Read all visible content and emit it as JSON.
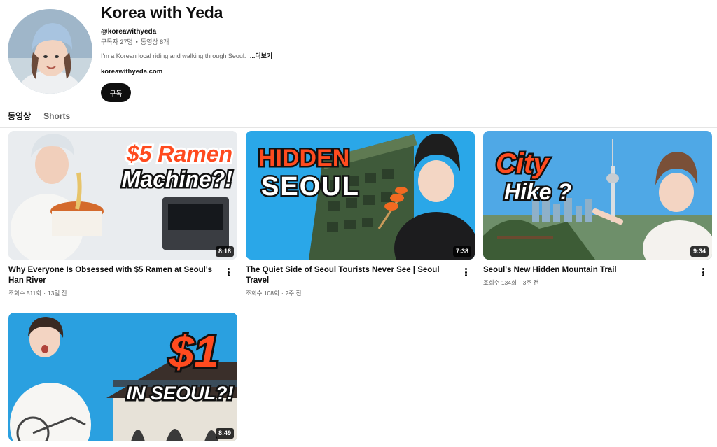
{
  "channel": {
    "title": "Korea with Yeda",
    "handle": "@koreawithyeda",
    "subscribers": "구독자 27명",
    "separator": "•",
    "video_count": "동영상 8개",
    "description": "I'm a Korean local riding and walking through Seoul.",
    "more_label": "...더보기",
    "website": "koreawithyeda.com",
    "subscribe_label": "구독"
  },
  "tabs": [
    {
      "label": "동영상",
      "active": true
    },
    {
      "label": "Shorts",
      "active": false
    }
  ],
  "videos": [
    {
      "title": "Why Everyone Is Obsessed with $5 Ramen at Seoul's Han River",
      "views": "조회수 511회",
      "age": "13일 전",
      "duration": "8:18",
      "thumb_text_1": "$5 Ramen",
      "thumb_text_2": "Machine?!"
    },
    {
      "title": "The Quiet Side of Seoul Tourists Never See | Seoul Travel",
      "views": "조회수 108회",
      "age": "2주 전",
      "duration": "7:38",
      "thumb_text_1": "HIDDEN",
      "thumb_text_2": "SEOUL"
    },
    {
      "title": "Seoul's New Hidden Mountain Trail",
      "views": "조회수 134회",
      "age": "3주 전",
      "duration": "9:34",
      "thumb_text_1": "City",
      "thumb_text_2": "Hike ?"
    },
    {
      "title": "",
      "views": "",
      "age": "",
      "duration": "8:49",
      "thumb_text_1": "$1",
      "thumb_text_2": "IN SEOUL?!"
    }
  ],
  "meta_dot": "·",
  "colors": {
    "accent_orange": "#ff4b1f",
    "sky_blue": "#2aa7e8",
    "text_primary": "#0f0f0f",
    "text_secondary": "#606060"
  }
}
